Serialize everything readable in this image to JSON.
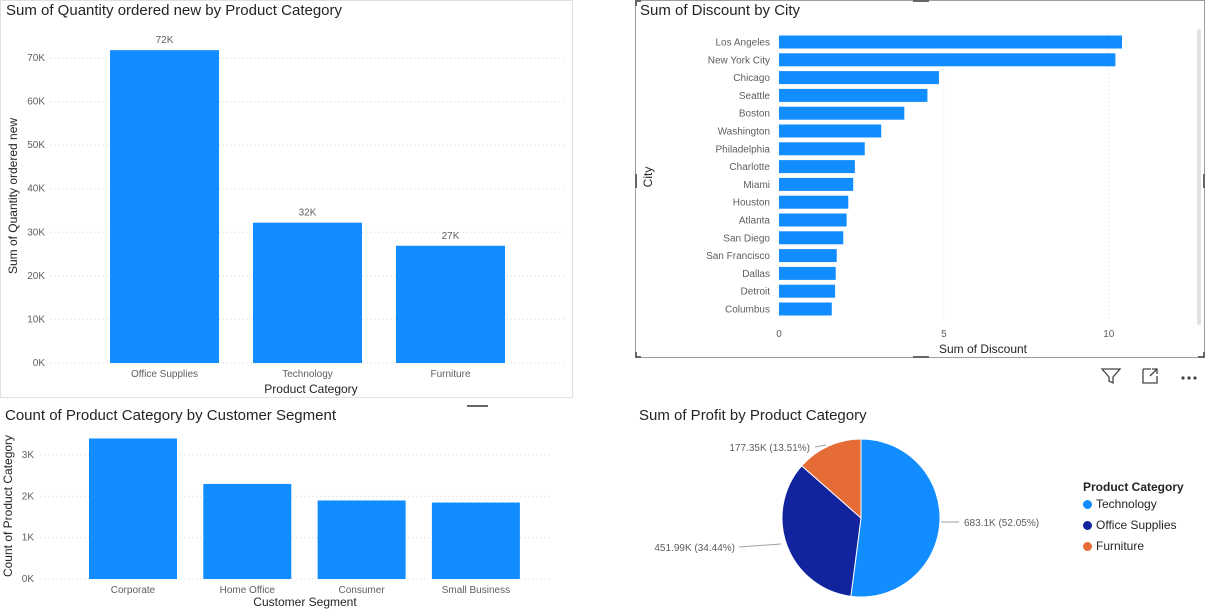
{
  "colors": {
    "bar": "#118DFF",
    "technology": "#118DFF",
    "office_supplies": "#12239E",
    "furniture": "#E66C37"
  },
  "icons": {
    "filter": "filter-icon",
    "focus": "focus-mode-icon",
    "more": "more-options-icon"
  },
  "chart_data": [
    {
      "type": "bar",
      "title": "Sum of Quantity ordered new by Product Category",
      "xlabel": "Product Category",
      "ylabel": "Sum of Quantity ordered new",
      "categories": [
        "Office Supplies",
        "Technology",
        "Furniture"
      ],
      "values": [
        71800,
        32200,
        26900
      ],
      "data_labels": [
        "72K",
        "32K",
        "27K"
      ],
      "ylim": [
        0,
        70000
      ],
      "yticks": [
        0,
        10000,
        20000,
        30000,
        40000,
        50000,
        60000,
        70000
      ],
      "ytick_labels": [
        "0K",
        "10K",
        "20K",
        "30K",
        "40K",
        "50K",
        "60K",
        "70K"
      ],
      "grid": true
    },
    {
      "type": "bar",
      "orientation": "horizontal",
      "title": "Sum of Discount by City",
      "xlabel": "Sum of Discount",
      "ylabel": "City",
      "categories": [
        "Los Angeles",
        "New York City",
        "Chicago",
        "Seattle",
        "Boston",
        "Washington",
        "Philadelphia",
        "Charlotte",
        "Miami",
        "Houston",
        "Atlanta",
        "San Diego",
        "San Francisco",
        "Dallas",
        "Detroit",
        "Columbus"
      ],
      "values": [
        10.4,
        10.2,
        4.85,
        4.5,
        3.8,
        3.1,
        2.6,
        2.3,
        2.25,
        2.1,
        2.05,
        1.95,
        1.75,
        1.72,
        1.7,
        1.6
      ],
      "xlim": [
        0,
        10.4
      ],
      "xticks": [
        0,
        5,
        10
      ],
      "xtick_labels": [
        "0",
        "5",
        "10"
      ],
      "grid": true
    },
    {
      "type": "bar",
      "title": "Count of Product Category by Customer Segment",
      "xlabel": "Customer Segment",
      "ylabel": "Count of Product Category",
      "categories": [
        "Corporate",
        "Home Office",
        "Consumer",
        "Small Business"
      ],
      "values": [
        3400,
        2300,
        1900,
        1850
      ],
      "ylim": [
        0,
        3000
      ],
      "yticks": [
        0,
        1000,
        2000,
        3000
      ],
      "ytick_labels": [
        "0K",
        "1K",
        "2K",
        "3K"
      ],
      "grid": true
    },
    {
      "type": "pie",
      "title": "Sum of Profit by Product Category",
      "legend_title": "Product Category",
      "legend_position": "right",
      "slices": [
        {
          "name": "Technology",
          "value": 683.1,
          "label": "683.1K (52.05%)",
          "percent": 52.05
        },
        {
          "name": "Office Supplies",
          "value": 451.99,
          "label": "451.99K (34.44%)",
          "percent": 34.44
        },
        {
          "name": "Furniture",
          "value": 177.35,
          "label": "177.35K (13.51%)",
          "percent": 13.51
        }
      ]
    }
  ]
}
